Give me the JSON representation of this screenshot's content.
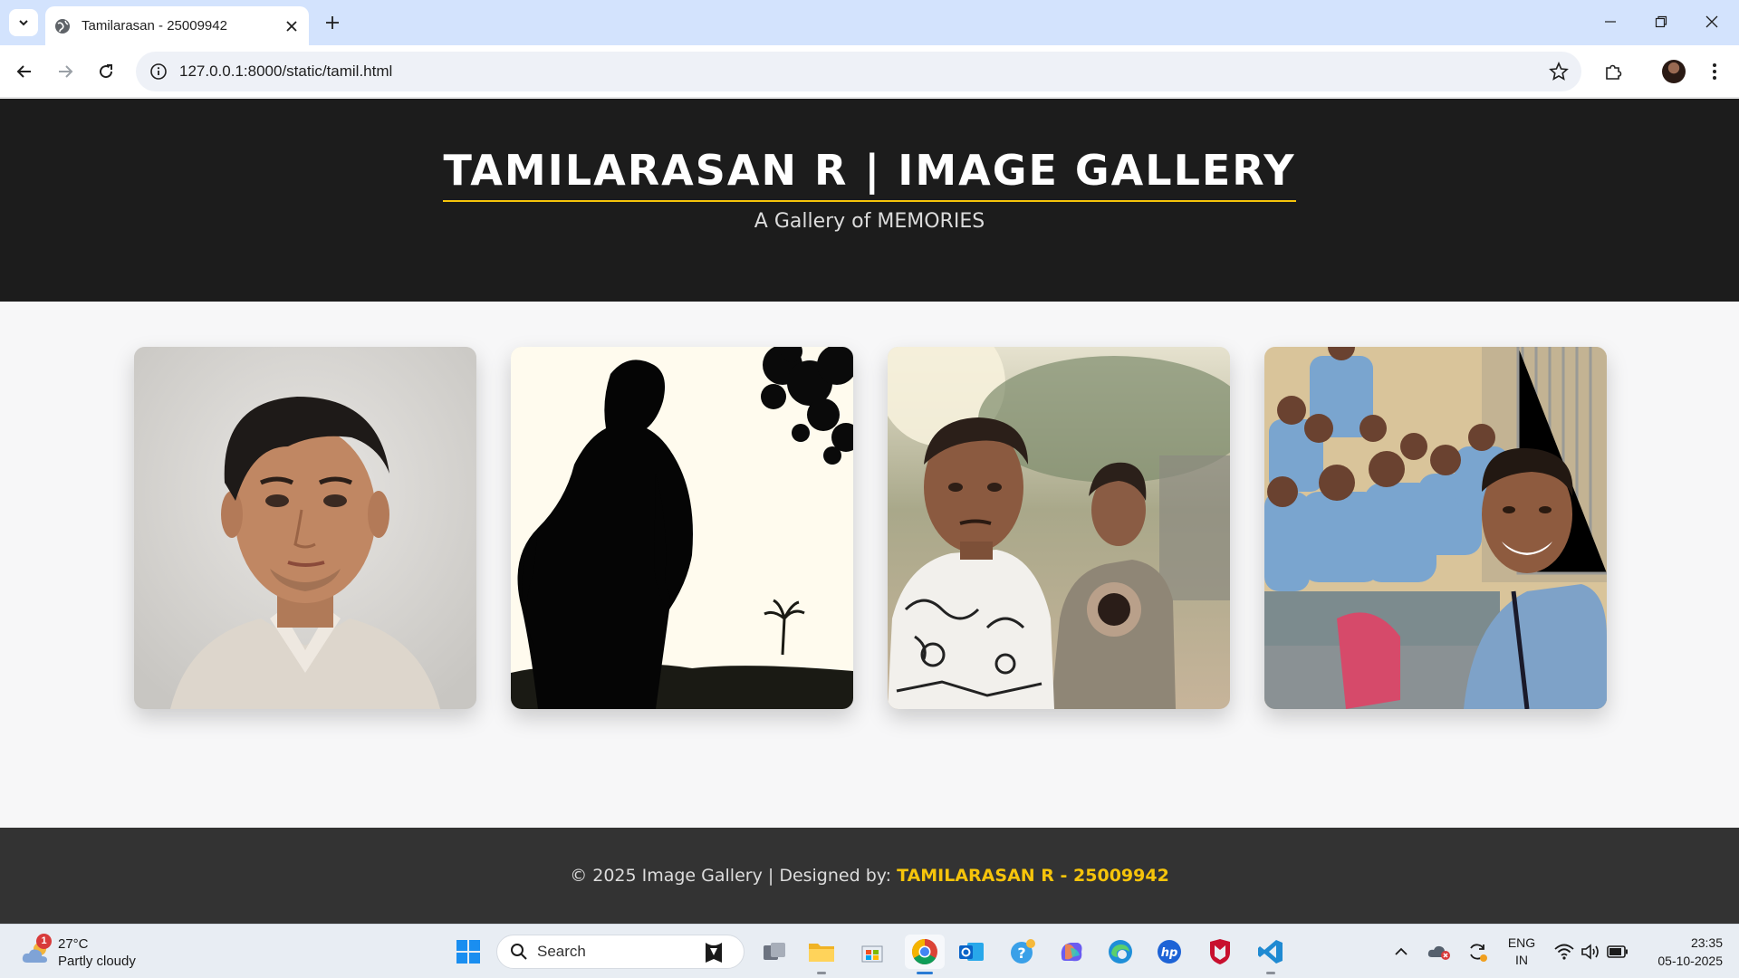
{
  "browser": {
    "tab_title": "Tamilarasan - 25009942",
    "url": "127.0.0.1:8000/static/tamil.html"
  },
  "page": {
    "title": "TAMILARASAN R | IMAGE GALLERY",
    "subtitle": "A Gallery of MEMORIES",
    "gallery": [
      {
        "subject": "portrait photo"
      },
      {
        "subject": "silhouette photo"
      },
      {
        "subject": "two friends outdoor photo"
      },
      {
        "subject": "classroom group selfie"
      }
    ],
    "footer": {
      "prefix": "© 2025 Image Gallery | Designed by: ",
      "designer": "TAMILARASAN R - 25009942"
    },
    "colors": {
      "accent": "#f6c40b",
      "hero_bg": "#1c1c1c",
      "footer_bg": "#333333"
    }
  },
  "taskbar": {
    "weather": {
      "badge": "1",
      "temp": "27°C",
      "desc": "Partly cloudy"
    },
    "search_placeholder": "Search",
    "language": {
      "line1": "ENG",
      "line2": "IN"
    },
    "clock": {
      "time": "23:35",
      "date": "05-10-2025"
    }
  }
}
